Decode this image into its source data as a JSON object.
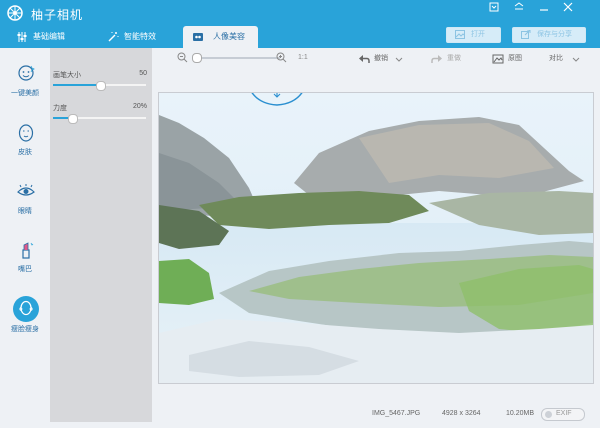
{
  "app": {
    "title": "柚子相机"
  },
  "window_controls": {
    "menu": "▾",
    "restore": "⊟",
    "minimize": "—",
    "close": "✕"
  },
  "tabs": [
    {
      "label": "基础编辑",
      "icon": "sliders-icon"
    },
    {
      "label": "智能特效",
      "icon": "magic-wand-icon"
    },
    {
      "label": "人像美容",
      "icon": "portrait-icon",
      "active": true
    }
  ],
  "header_buttons": {
    "open": "打开",
    "save_share": "保存与分享"
  },
  "leftnav": [
    {
      "label": "一键美颜",
      "icon": "face-beauty-icon"
    },
    {
      "label": "皮肤",
      "icon": "skin-icon"
    },
    {
      "label": "眼睛",
      "icon": "eye-icon"
    },
    {
      "label": "嘴巴",
      "icon": "lipstick-icon"
    },
    {
      "label": "瘦脸瘦身",
      "icon": "slim-face-icon",
      "active": true
    }
  ],
  "panel": {
    "brush_size": {
      "label": "画笔大小",
      "value": "50",
      "fraction": 0.5
    },
    "strength": {
      "label": "力度",
      "value": "20%",
      "fraction": 0.2
    }
  },
  "toolbar": {
    "zoom_ratio": "1:1",
    "zoom_fraction": 0.0,
    "undo": "撤销",
    "redo": "重做",
    "original": "原图",
    "compare": "对比"
  },
  "status": {
    "filename": "IMG_5467.JPG",
    "dimensions": "4928 x 3264",
    "filesize": "10.20MB",
    "exif": "EXIF"
  },
  "colors": {
    "accent": "#29a3d9",
    "panel": "#d7d8db",
    "background": "#eef1f5"
  }
}
